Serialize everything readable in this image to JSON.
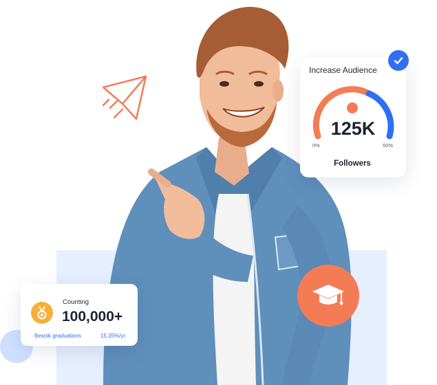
{
  "audience_card": {
    "title": "Increase Audience",
    "value": "125K",
    "min_label": "0%",
    "max_label": "50%",
    "label": "Followers"
  },
  "counting_card": {
    "title": "Counting",
    "value": "100,000+",
    "footer_left": "Besnik graduations",
    "footer_right": "15.35%/yr"
  },
  "icons": {
    "plane": "paper-plane-icon",
    "check": "check-icon",
    "graduation": "graduation-cap-icon",
    "medal": "medal-icon"
  },
  "colors": {
    "accent_orange": "#f47c55",
    "accent_blue": "#2f6ff2",
    "medal_yellow": "#f6b03a",
    "panel_blue": "#e6efff"
  }
}
